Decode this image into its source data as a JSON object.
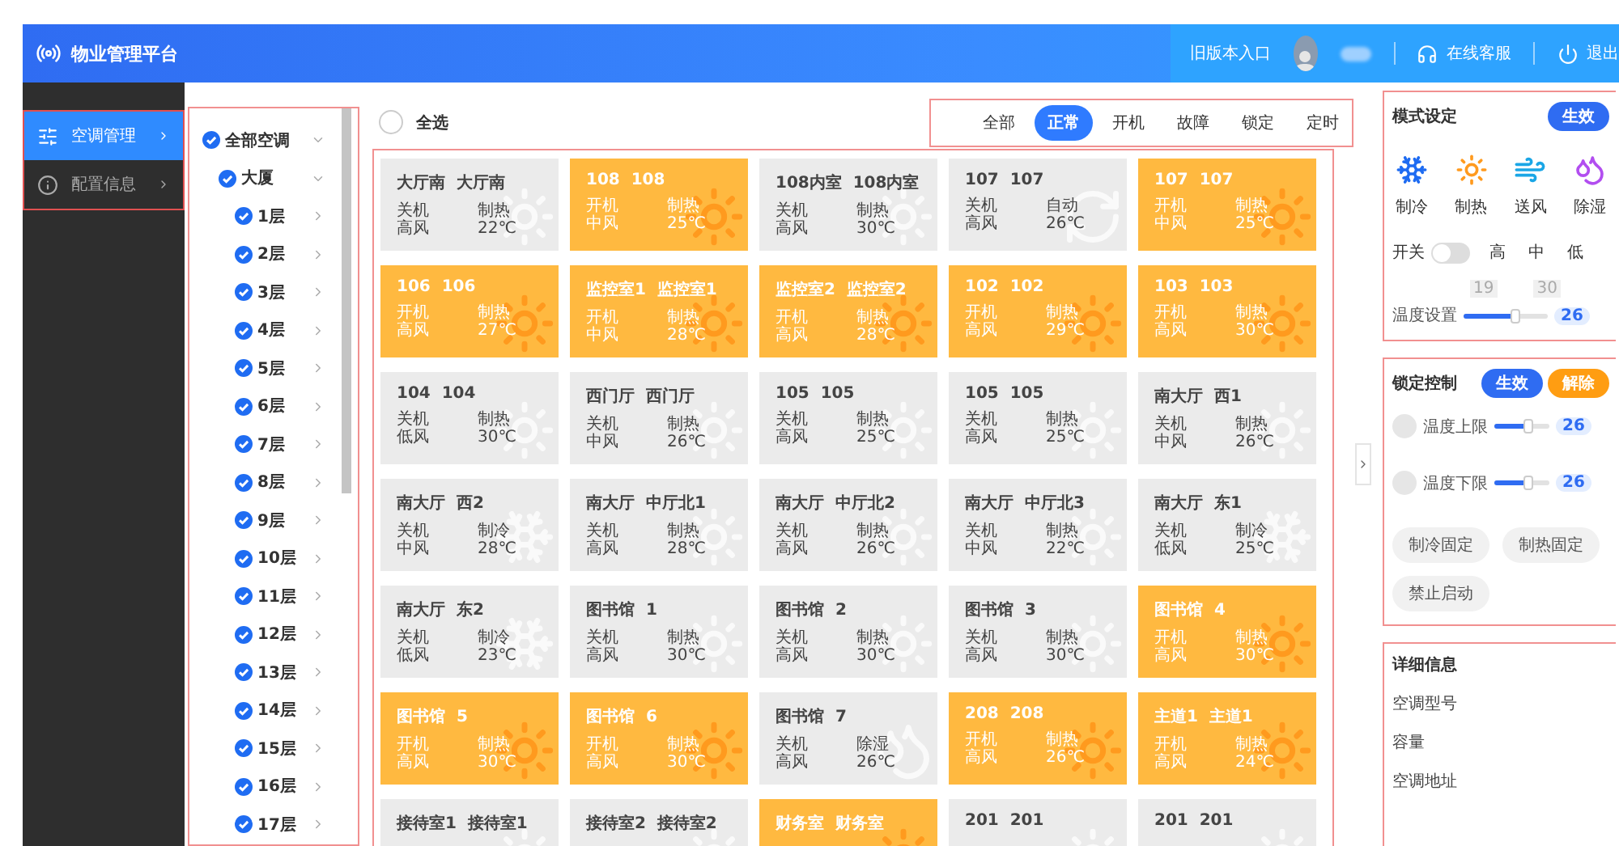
{
  "header": {
    "title": "物业管理平台",
    "old_version": "旧版本入口",
    "support": "在线客服",
    "logout": "退出"
  },
  "sidebar": {
    "items": [
      {
        "label": "空调管理",
        "kind": "sliders",
        "selected": true
      },
      {
        "label": "配置信息",
        "kind": "info",
        "selected": false
      }
    ]
  },
  "tree": {
    "root": {
      "label": "全部空调",
      "checked": true,
      "expanded": true,
      "children": [
        {
          "label": "大厦",
          "checked": true,
          "expanded": true,
          "children": [
            {
              "label": "1层",
              "checked": true
            },
            {
              "label": "2层",
              "checked": true
            },
            {
              "label": "3层",
              "checked": true
            },
            {
              "label": "4层",
              "checked": true
            },
            {
              "label": "5层",
              "checked": true
            },
            {
              "label": "6层",
              "checked": true
            },
            {
              "label": "7层",
              "checked": true
            },
            {
              "label": "8层",
              "checked": true
            },
            {
              "label": "9层",
              "checked": true
            },
            {
              "label": "10层",
              "checked": true
            },
            {
              "label": "11层",
              "checked": true
            },
            {
              "label": "12层",
              "checked": true
            },
            {
              "label": "13层",
              "checked": true
            },
            {
              "label": "14层",
              "checked": true
            },
            {
              "label": "15层",
              "checked": true
            },
            {
              "label": "16层",
              "checked": true
            },
            {
              "label": "17层",
              "checked": true
            }
          ]
        }
      ]
    }
  },
  "select_all": {
    "label": "全选",
    "checked": false
  },
  "filters": [
    {
      "label": "全部",
      "selected": false
    },
    {
      "label": "正常",
      "selected": true
    },
    {
      "label": "开机",
      "selected": false
    },
    {
      "label": "故障",
      "selected": false
    },
    {
      "label": "锁定",
      "selected": false
    },
    {
      "label": "定时",
      "selected": false
    }
  ],
  "cards": [
    {
      "title": "大厅南  大厅南",
      "on": false,
      "kind": "sun",
      "power": "关机",
      "fan": "高风",
      "mode": "制热",
      "temp": "22℃"
    },
    {
      "title": "108  108",
      "on": true,
      "kind": "sun",
      "power": "开机",
      "fan": "中风",
      "mode": "制热",
      "temp": "25℃"
    },
    {
      "title": "108内室  108内室",
      "on": false,
      "kind": "sun",
      "power": "关机",
      "fan": "高风",
      "mode": "制热",
      "temp": "30℃"
    },
    {
      "title": "107  107",
      "on": false,
      "kind": "auto",
      "power": "关机",
      "fan": "高风",
      "mode": "自动",
      "temp": "26℃"
    },
    {
      "title": "107  107",
      "on": true,
      "kind": "sun",
      "power": "开机",
      "fan": "中风",
      "mode": "制热",
      "temp": "25℃"
    },
    {
      "title": "106  106",
      "on": true,
      "kind": "sun",
      "power": "开机",
      "fan": "高风",
      "mode": "制热",
      "temp": "27℃"
    },
    {
      "title": "监控室1  监控室1",
      "on": true,
      "kind": "sun",
      "power": "开机",
      "fan": "中风",
      "mode": "制热",
      "temp": "28℃"
    },
    {
      "title": "监控室2  监控室2",
      "on": true,
      "kind": "sun",
      "power": "开机",
      "fan": "高风",
      "mode": "制热",
      "temp": "28℃"
    },
    {
      "title": "102  102",
      "on": true,
      "kind": "sun",
      "power": "开机",
      "fan": "高风",
      "mode": "制热",
      "temp": "29℃"
    },
    {
      "title": "103  103",
      "on": true,
      "kind": "sun",
      "power": "开机",
      "fan": "高风",
      "mode": "制热",
      "temp": "30℃"
    },
    {
      "title": "104  104",
      "on": false,
      "kind": "sun",
      "power": "关机",
      "fan": "低风",
      "mode": "制热",
      "temp": "30℃"
    },
    {
      "title": "西门厅  西门厅",
      "on": false,
      "kind": "sun",
      "power": "关机",
      "fan": "中风",
      "mode": "制热",
      "temp": "26℃"
    },
    {
      "title": "105  105",
      "on": false,
      "kind": "sun",
      "power": "关机",
      "fan": "高风",
      "mode": "制热",
      "temp": "25℃"
    },
    {
      "title": "105  105",
      "on": false,
      "kind": "sun",
      "power": "关机",
      "fan": "高风",
      "mode": "制热",
      "temp": "25℃"
    },
    {
      "title": "南大厅  西1",
      "on": false,
      "kind": "sun",
      "power": "关机",
      "fan": "中风",
      "mode": "制热",
      "temp": "26℃"
    },
    {
      "title": "南大厅  西2",
      "on": false,
      "kind": "snow",
      "power": "关机",
      "fan": "中风",
      "mode": "制冷",
      "temp": "28℃"
    },
    {
      "title": "南大厅  中厅北1",
      "on": false,
      "kind": "sun",
      "power": "关机",
      "fan": "高风",
      "mode": "制热",
      "temp": "28℃"
    },
    {
      "title": "南大厅  中厅北2",
      "on": false,
      "kind": "sun",
      "power": "关机",
      "fan": "高风",
      "mode": "制热",
      "temp": "26℃"
    },
    {
      "title": "南大厅  中厅北3",
      "on": false,
      "kind": "sun",
      "power": "关机",
      "fan": "中风",
      "mode": "制热",
      "temp": "22℃"
    },
    {
      "title": "南大厅  东1",
      "on": false,
      "kind": "snow",
      "power": "关机",
      "fan": "低风",
      "mode": "制冷",
      "temp": "25℃"
    },
    {
      "title": "南大厅  东2",
      "on": false,
      "kind": "snow",
      "power": "关机",
      "fan": "低风",
      "mode": "制冷",
      "temp": "23℃"
    },
    {
      "title": "图书馆  1",
      "on": false,
      "kind": "sun",
      "power": "关机",
      "fan": "高风",
      "mode": "制热",
      "temp": "30℃"
    },
    {
      "title": "图书馆  2",
      "on": false,
      "kind": "sun",
      "power": "关机",
      "fan": "高风",
      "mode": "制热",
      "temp": "30℃"
    },
    {
      "title": "图书馆  3",
      "on": false,
      "kind": "sun",
      "power": "关机",
      "fan": "高风",
      "mode": "制热",
      "temp": "30℃"
    },
    {
      "title": "图书馆  4",
      "on": true,
      "kind": "sun",
      "power": "开机",
      "fan": "高风",
      "mode": "制热",
      "temp": "30℃"
    },
    {
      "title": "图书馆  5",
      "on": true,
      "kind": "sun",
      "power": "开机",
      "fan": "高风",
      "mode": "制热",
      "temp": "30℃"
    },
    {
      "title": "图书馆  6",
      "on": true,
      "kind": "sun",
      "power": "开机",
      "fan": "高风",
      "mode": "制热",
      "temp": "30℃"
    },
    {
      "title": "图书馆  7",
      "on": false,
      "kind": "drop",
      "power": "关机",
      "fan": "高风",
      "mode": "除湿",
      "temp": "26℃"
    },
    {
      "title": "208  208",
      "on": true,
      "kind": "sun",
      "power": "开机",
      "fan": "高风",
      "mode": "制热",
      "temp": "26℃"
    },
    {
      "title": "主道1  主道1",
      "on": true,
      "kind": "sun",
      "power": "开机",
      "fan": "高风",
      "mode": "制热",
      "temp": "24℃"
    },
    {
      "title": "接待室1  接待室1",
      "on": false,
      "kind": "sun"
    },
    {
      "title": "接待室2  接待室2",
      "on": false,
      "kind": "sun"
    },
    {
      "title": "财务室  财务室",
      "on": true,
      "kind": "sun"
    },
    {
      "title": "201  201",
      "on": false,
      "kind": "sun"
    },
    {
      "title": "201  201",
      "on": false,
      "kind": "sun"
    }
  ],
  "mode_panel": {
    "title": "模式设定",
    "apply": "生效",
    "modes": [
      {
        "label": "制冷",
        "kind": "snow"
      },
      {
        "label": "制热",
        "kind": "sun"
      },
      {
        "label": "送风",
        "kind": "wind"
      },
      {
        "label": "除湿",
        "kind": "drop"
      }
    ],
    "switch": {
      "label": "开关",
      "on": false
    },
    "speeds": [
      "高",
      "中",
      "低"
    ],
    "temperature": {
      "label": "温度设置",
      "min": "19",
      "max": "30",
      "level": 0.62,
      "reading": "26"
    }
  },
  "lock_panel": {
    "title": "锁定控制",
    "apply": "生效",
    "release": "解除",
    "limits": [
      {
        "label": "温度上限",
        "checked": false,
        "level": 0.62,
        "reading": "26"
      },
      {
        "label": "温度下限",
        "checked": false,
        "level": 0.62,
        "reading": "26"
      }
    ],
    "buttons": [
      "制冷固定",
      "制热固定",
      "禁止启动"
    ]
  },
  "details": {
    "title": "详细信息",
    "fields": [
      "空调型号",
      "容量",
      "空调地址"
    ]
  }
}
